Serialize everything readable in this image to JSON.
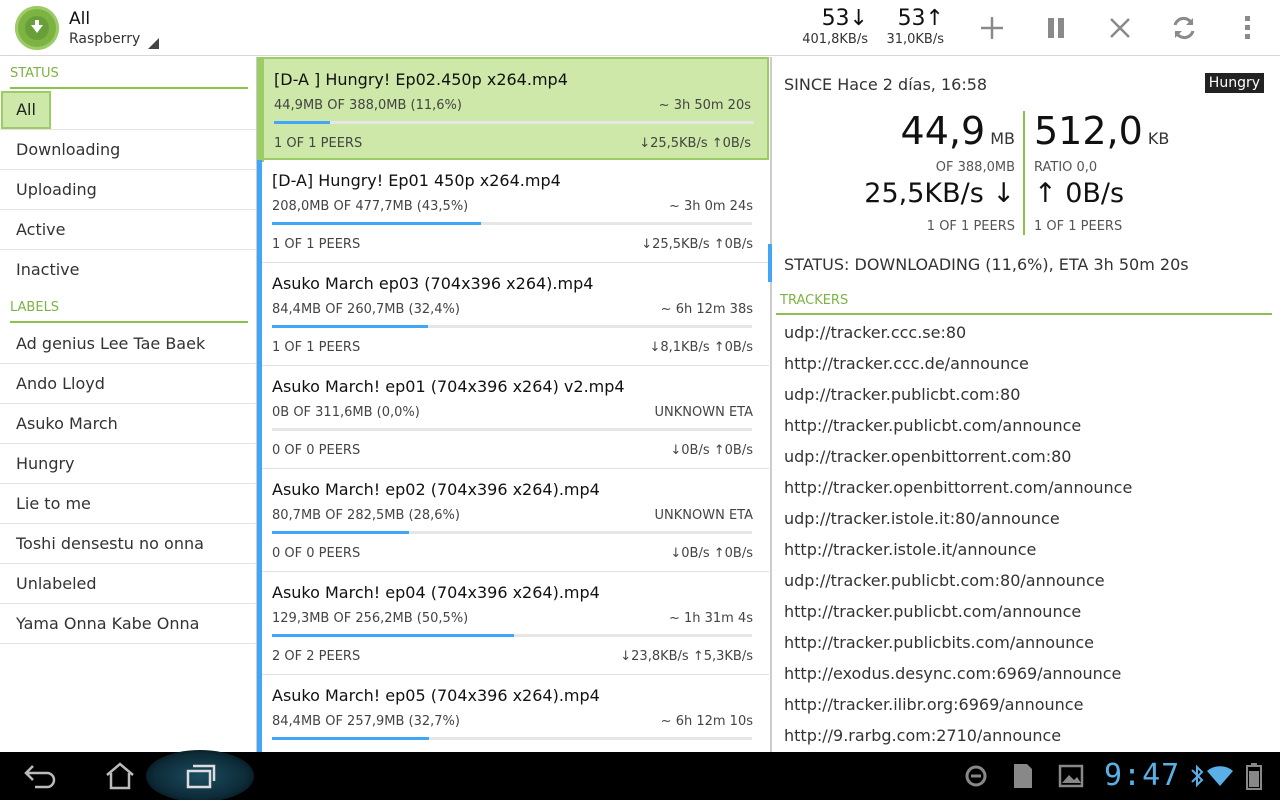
{
  "actionbar": {
    "title": "All",
    "subtitle": "Raspberry",
    "download_count": "53↓",
    "download_rate": "401,8KB/s",
    "upload_count": "53↑",
    "upload_rate": "31,0KB/s",
    "icons": [
      "add-icon",
      "pause-icon",
      "close-icon",
      "refresh-icon",
      "overflow-menu-icon"
    ]
  },
  "sidebar": {
    "status_header": "STATUS",
    "status_items": [
      "All",
      "Downloading",
      "Uploading",
      "Active",
      "Inactive"
    ],
    "labels_header": "LABELS",
    "label_items": [
      "Ad genius Lee Tae Baek",
      "Ando Lloyd",
      "Asuko March",
      "Hungry",
      "Lie to me",
      "Toshi densestu no onna",
      "Unlabeled",
      "Yama Onna Kabe Onna"
    ]
  },
  "torrents": [
    {
      "name": "[D-A ] Hungry! Ep02.450p x264.mp4",
      "size": "44,9MB OF 388,0MB (11,6%)",
      "eta": "~ 3h 50m 20s",
      "progress": 0.116,
      "peers": "1 OF 1 PEERS",
      "speeds": "↓25,5KB/s ↑0B/s",
      "selected": true
    },
    {
      "name": "[D-A] Hungry! Ep01 450p x264.mp4",
      "size": "208,0MB OF 477,7MB (43,5%)",
      "eta": "~ 3h 0m 24s",
      "progress": 0.435,
      "peers": "1 OF 1 PEERS",
      "speeds": "↓25,5KB/s ↑0B/s"
    },
    {
      "name": "Asuko March ep03 (704x396 x264).mp4",
      "size": "84,4MB OF 260,7MB (32,4%)",
      "eta": "~ 6h 12m 38s",
      "progress": 0.324,
      "peers": "1 OF 1 PEERS",
      "speeds": "↓8,1KB/s ↑0B/s"
    },
    {
      "name": "Asuko March! ep01 (704x396 x264) v2.mp4",
      "size": "0B OF 311,6MB (0,0%)",
      "eta": "UNKNOWN ETA",
      "progress": 0.0,
      "peers": "0 OF 0 PEERS",
      "speeds": "↓0B/s ↑0B/s"
    },
    {
      "name": "Asuko March! ep02 (704x396 x264).mp4",
      "size": "80,7MB OF 282,5MB (28,6%)",
      "eta": "UNKNOWN ETA",
      "progress": 0.286,
      "peers": "0 OF 0 PEERS",
      "speeds": "↓0B/s ↑0B/s"
    },
    {
      "name": "Asuko March! ep04 (704x396 x264).mp4",
      "size": "129,3MB OF 256,2MB (50,5%)",
      "eta": "~ 1h 31m 4s",
      "progress": 0.505,
      "peers": "2 OF 2 PEERS",
      "speeds": "↓23,8KB/s ↑5,3KB/s"
    },
    {
      "name": "Asuko March! ep05 (704x396 x264).mp4",
      "size": "84,4MB OF 257,9MB (32,7%)",
      "eta": "~ 6h 12m 10s",
      "progress": 0.327,
      "peers": "",
      "speeds": ""
    }
  ],
  "details": {
    "since": "SINCE Hace 2 días, 16:58",
    "label": "Hungry",
    "downloaded_value": "44,9",
    "downloaded_unit": "MB",
    "downloaded_of": "OF 388,0MB",
    "uploaded_value": "512,0",
    "uploaded_unit": "KB",
    "ratio": "RATIO 0,0",
    "down_speed": "25,5KB/s ↓",
    "up_speed": "↑ 0B/s",
    "down_peers": "1 OF 1 PEERS",
    "up_peers": "1 OF 1 PEERS",
    "status": "STATUS: DOWNLOADING (11,6%), ETA 3h 50m 20s",
    "trackers_header": "TRACKERS",
    "trackers": [
      "udp://tracker.ccc.se:80",
      "http://tracker.ccc.de/announce",
      "udp://tracker.publicbt.com:80",
      "http://tracker.publicbt.com/announce",
      "udp://tracker.openbittorrent.com:80",
      "http://tracker.openbittorrent.com/announce",
      "udp://tracker.istole.it:80/announce",
      "http://tracker.istole.it/announce",
      "udp://tracker.publicbt.com:80/announce",
      "http://tracker.publicbt.com/announce",
      "http://tracker.publicbits.com/announce",
      "http://exodus.desync.com:6969/announce",
      "http://tracker.ilibr.org:6969/announce",
      "http://9.rarbg.com:2710/announce"
    ]
  },
  "system": {
    "clock": "9:47",
    "accent": "#8bc34a",
    "progress_color": "#42a5f5"
  }
}
